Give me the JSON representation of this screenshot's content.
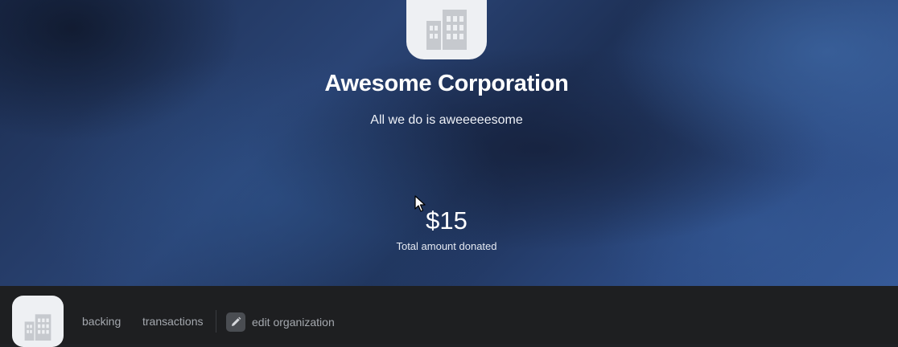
{
  "organization": {
    "name": "Awesome Corporation",
    "tagline": "All we do is aweeeeesome",
    "logo_icon": "building-icon"
  },
  "stats": {
    "amount": "$15",
    "label": "Total amount donated"
  },
  "nav": {
    "logo_icon": "building-icon",
    "backing_label": "backing",
    "transactions_label": "transactions",
    "edit_label": "edit organization",
    "edit_icon": "pencil-icon"
  },
  "colors": {
    "hero_bg": "#22375f",
    "nav_bg": "#1e1f21",
    "logo_bg": "#eef0f3",
    "logo_icon": "#c6c9ce",
    "nav_text": "#a4a8ae"
  }
}
